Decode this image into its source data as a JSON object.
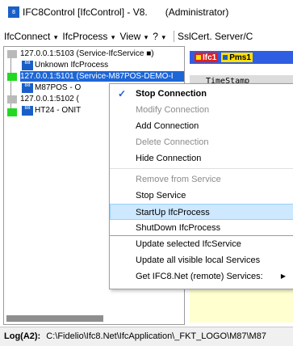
{
  "window": {
    "title": "IFC8Control [IfcControl] - V8.",
    "role": "(Administrator)",
    "icon": "ifc8-app-icon"
  },
  "menubar": {
    "items": [
      {
        "label": "IfcConnect"
      },
      {
        "label": "IfcProcess"
      },
      {
        "label": "View"
      },
      {
        "label": "?"
      },
      {
        "label": "SslCert. Server/C"
      }
    ]
  },
  "tree": {
    "rows": [
      {
        "label": "127.0.0.1:5103 (Service-IfcService ■)"
      },
      {
        "label": "Unknown IfcProcess"
      },
      {
        "label": "127.0.0.1:5101 (Service-M87POS-DEMO-I"
      },
      {
        "label": "M87POS - O"
      },
      {
        "label": "127.0.0.1:5102 ("
      },
      {
        "label": "HT24 - ONIT"
      }
    ],
    "colors": {
      "selected": "#1e66d6",
      "green": "#22d822",
      "grey": "#b9b9b9"
    }
  },
  "right": {
    "chips": [
      {
        "label": "Ifc1",
        "color": "#e02020"
      },
      {
        "label": "Pms1",
        "color": "#ffe000"
      }
    ],
    "timestamp_header": "TimeStamp"
  },
  "context_menu": {
    "items": [
      {
        "label": "Stop Connection",
        "state": "bold",
        "checked": true
      },
      {
        "label": "Modify Connection",
        "state": "disabled"
      },
      {
        "label": "Add Connection",
        "state": "normal"
      },
      {
        "label": "Delete Connection",
        "state": "disabled"
      },
      {
        "label": "Hide Connection",
        "state": "normal"
      },
      {
        "label": "Remove from Service",
        "state": "disabled"
      },
      {
        "label": "Stop Service",
        "state": "normal"
      },
      {
        "label": "StartUp IfcProcess",
        "state": "highlight"
      },
      {
        "label": "ShutDown IfcProcess",
        "state": "normal"
      },
      {
        "label": "Update selected IfcService",
        "state": "normal"
      },
      {
        "label": "Update all visible local Services",
        "state": "normal"
      },
      {
        "label": "Get IFC8.Net (remote) Services:",
        "state": "submenu"
      }
    ],
    "highlight_color": "#cde8ff"
  },
  "log": {
    "label": "Log(A2):",
    "path": "C:\\Fidelio\\Ifc8.Net\\IfcApplication\\_FKT_LOGO\\M87\\M87"
  }
}
